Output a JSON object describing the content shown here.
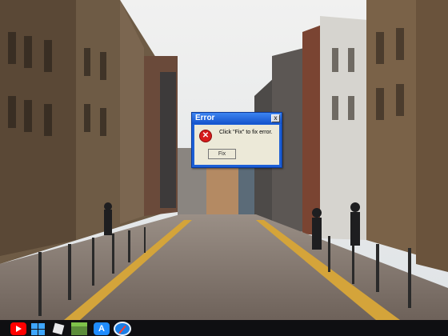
{
  "dialog": {
    "title": "Error",
    "close_glyph": "x",
    "error_icon_glyph": "✕",
    "message": "Click \"Fix\" to fix error.",
    "fix_button_label": "Fix"
  },
  "taskbar": {
    "icons": [
      "youtube-icon",
      "windows-icon",
      "roblox-icon",
      "minecraft-icon",
      "app-store-icon",
      "safari-icon"
    ]
  },
  "wallpaper": {
    "description_colors": {
      "sky": "#e6e8ea",
      "street": "#8a7e75",
      "building": "#6b5a45"
    }
  }
}
